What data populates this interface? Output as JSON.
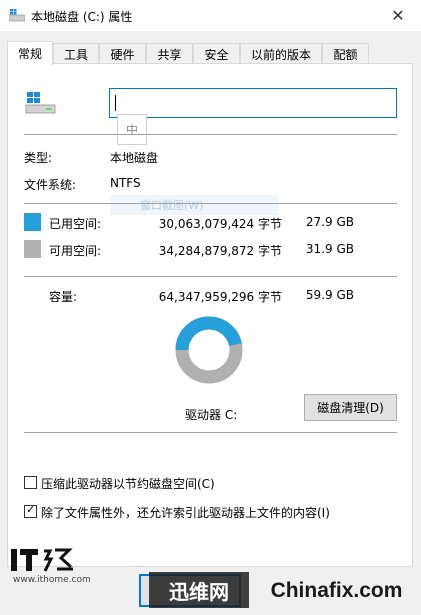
{
  "window": {
    "title": "本地磁盘 (C:) 属性",
    "close_symbol": "✕"
  },
  "tabs": [
    {
      "label": "常规",
      "active": true
    },
    {
      "label": "工具",
      "active": false
    },
    {
      "label": "硬件",
      "active": false
    },
    {
      "label": "共享",
      "active": false
    },
    {
      "label": "安全",
      "active": false
    },
    {
      "label": "以前的版本",
      "active": false
    },
    {
      "label": "配额",
      "active": false
    }
  ],
  "general": {
    "name_input_value": "",
    "ime_indicator": "中",
    "ghost_text": "窗口截图(W)",
    "type_label": "类型:",
    "type_value": "本地磁盘",
    "fs_label": "文件系统:",
    "fs_value": "NTFS",
    "used": {
      "label": "已用空间:",
      "bytes": "30,063,079,424 字节",
      "size": "27.9 GB",
      "color": "#26a0da"
    },
    "free": {
      "label": "可用空间:",
      "bytes": "34,284,879,872 字节",
      "size": "31.9 GB",
      "color": "#b0b0b0"
    },
    "capacity": {
      "label": "容量:",
      "bytes": "64,347,959,296 字节",
      "size": "59.9 GB"
    },
    "donut": {
      "used_fraction": 0.467
    },
    "drive_label": "驱动器 C:",
    "cleanup_button": "磁盘清理(D)",
    "compress_option": {
      "label": "压缩此驱动器以节约磁盘空间(C)",
      "checked": false
    },
    "index_option": {
      "label": "除了文件属性外，还允许索引此驱动器上文件的内容(I)",
      "checked": true
    }
  },
  "watermarks": {
    "ithome_logo_text": "IT之家",
    "ithome_url": "www.ithome.com",
    "xunwei_text": "迅维网",
    "chinafix_text": "Chinafix.com"
  },
  "icons": {
    "title": "drive-icon",
    "drive": "windows-drive-icon",
    "close": "close-icon",
    "check": "checkmark-icon"
  }
}
